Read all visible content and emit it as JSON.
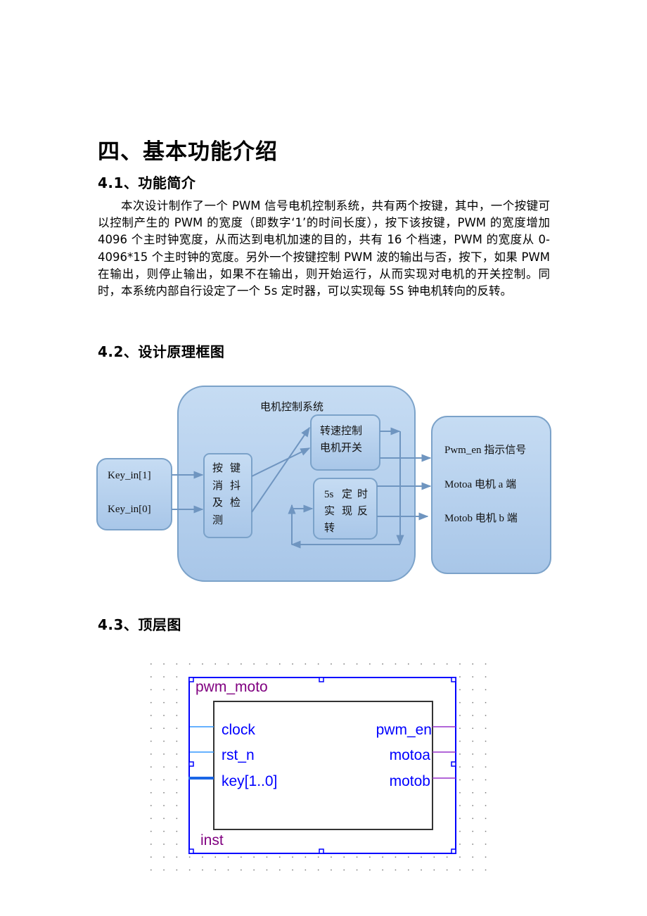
{
  "document": {
    "section_title": "四、基本功能介绍",
    "subsections": [
      {
        "title": "4.1、功能简介",
        "paragraph": "本次设计制作了一个 PWM 信号电机控制系统，共有两个按键，其中，一个按键可以控制产生的 PWM 的宽度（即数字‘1’的时间长度），按下该按键，PWM 的宽度增加 4096 个主时钟宽度，从而达到电机加速的目的，共有 16 个档速，PWM 的宽度从 0-4096*15 个主时钟的宽度。另外一个按键控制 PWM 波的输出与否，按下，如果 PWM 在输出，则停止输出，如果不在输出，则开始运行，从而实现对电机的开关控制。同时，本系统内部自行设定了一个 5s 定时器，可以实现每 5S 钟电机转向的反转。"
      },
      {
        "title": "4.2、设计原理框图"
      },
      {
        "title": "4.3、顶层图"
      }
    ]
  },
  "block_diagram": {
    "inputs": [
      "Key_in[1]",
      "Key_in[0]"
    ],
    "system_label": "电机控制系统",
    "debounce_block": [
      "按",
      "键",
      "消",
      "抖",
      "及",
      "检",
      "测"
    ],
    "speed_block": [
      "转速控制",
      "电机开关"
    ],
    "timer_block": [
      "5s",
      "定",
      "时",
      "实",
      "现",
      "反",
      "转"
    ],
    "outputs": [
      "Pwm_en 指示信号",
      "Motoa 电机 a 端",
      "Motob 电机 b 端"
    ],
    "colors": {
      "fill": "#b9d3ef",
      "stroke": "#7ba2c9",
      "arrow": "#6f95c0"
    }
  },
  "schematic": {
    "module_name": "pwm_moto",
    "instance_name": "inst",
    "inputs": [
      "clock",
      "rst_n",
      "key[1..0]"
    ],
    "outputs": [
      "pwm_en",
      "motoa",
      "motob"
    ],
    "colors": {
      "border": "#0000ff",
      "label": "#800080",
      "port_text": "#0000ff",
      "input_wire": "#3399ff",
      "output_wire": "#9933cc",
      "body": "#000000"
    }
  }
}
